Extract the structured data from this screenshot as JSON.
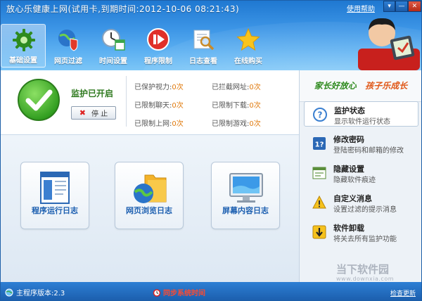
{
  "window": {
    "title": "放心乐健康上网(试用卡,到期时间:2012-10-06 08:21:43)",
    "help_label": "使用帮助",
    "menu_button": "▾",
    "minimize_button": "—",
    "close_button": "✕"
  },
  "toolbar": {
    "items": [
      {
        "label": "基础设置",
        "icon": "gear-icon"
      },
      {
        "label": "网页过滤",
        "icon": "globe-shield-icon"
      },
      {
        "label": "时间设置",
        "icon": "clock-calendar-icon"
      },
      {
        "label": "程序限制",
        "icon": "stop-play-icon"
      },
      {
        "label": "日志查看",
        "icon": "magnifier-icon"
      },
      {
        "label": "在线购买",
        "icon": "star-icon"
      }
    ]
  },
  "status": {
    "protection_text": "监护已开启",
    "stop_label": "停 止",
    "stats": [
      {
        "label": "已保护视力:",
        "value": "0次"
      },
      {
        "label": "已拦截网址:",
        "value": "0次"
      },
      {
        "label": "已限制聊天:",
        "value": "0次"
      },
      {
        "label": "已限制下载:",
        "value": "0次"
      },
      {
        "label": "已限制上网:",
        "value": "0次"
      },
      {
        "label": "已限制游戏:",
        "value": "0次"
      }
    ]
  },
  "logs": [
    {
      "label": "程序运行日志",
      "icon": "program-window-icon"
    },
    {
      "label": "网页浏览日志",
      "icon": "globe-folder-icon"
    },
    {
      "label": "屏幕内容日志",
      "icon": "monitor-icon"
    }
  ],
  "right_panel": {
    "slogan_part1": "家长好放心",
    "slogan_part2": "孩子乐成长",
    "items": [
      {
        "title": "监护状态",
        "desc": "显示软件运行状态",
        "icon": "question-icon"
      },
      {
        "title": "修改密码",
        "desc": "登陆密码和邮箱的修改",
        "icon": "password-icon"
      },
      {
        "title": "隐藏设置",
        "desc": "隐藏软件痕迹",
        "icon": "hide-icon"
      },
      {
        "title": "自定义消息",
        "desc": "设置过滤的提示消息",
        "icon": "warning-icon"
      },
      {
        "title": "软件卸载",
        "desc": "将关去所有监护功能",
        "icon": "uninstall-icon"
      }
    ],
    "watermark_title": "当下软件园",
    "watermark_url": "www.downxia.com"
  },
  "statusbar": {
    "version_label": "主程序版本:2.3",
    "sync_label": "同步系统时间",
    "update_label": "检查更新"
  },
  "colors": {
    "header_blue": "#1f78d1",
    "accent_orange": "#e07a0d",
    "protected_green": "#2f7a1f",
    "log_label_blue": "#1c5fb0"
  }
}
